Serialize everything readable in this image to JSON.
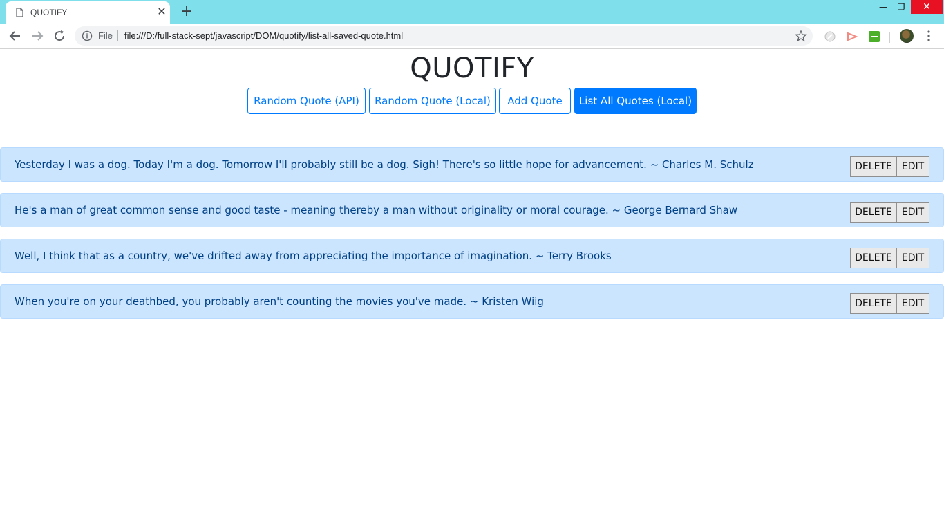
{
  "browser": {
    "tab_title": "QUOTIFY",
    "new_tab_label": "+",
    "close_tab_label": "✕",
    "scheme_label": "File",
    "url": "file:///D:/full-stack-sept/javascript/DOM/quotify/list-all-saved-quote.html",
    "window_controls": {
      "minimize": "—",
      "maximize": "❐",
      "close": "✕"
    },
    "colors": {
      "tabstrip": "#7fe0eb",
      "close": "#e81123"
    }
  },
  "page": {
    "title": "QUOTIFY",
    "nav_buttons": [
      {
        "label": "Random Quote (API)",
        "active": false
      },
      {
        "label": "Random Quote (Local)",
        "active": false
      },
      {
        "label": "Add Quote",
        "active": false
      },
      {
        "label": "List All Quotes (Local)",
        "active": true
      }
    ],
    "quotes": [
      {
        "text": "Yesterday I was a dog. Today I'm a dog. Tomorrow I'll probably still be a dog. Sigh! There's so little hope for advancement. ~ Charles M. Schulz",
        "delete_label": "DELETE",
        "edit_label": "EDIT"
      },
      {
        "text": "He's a man of great common sense and good taste - meaning thereby a man without originality or moral courage. ~ George Bernard Shaw",
        "delete_label": "DELETE",
        "edit_label": "EDIT"
      },
      {
        "text": "Well, I think that as a country, we've drifted away from appreciating the importance of imagination. ~ Terry Brooks",
        "delete_label": "DELETE",
        "edit_label": "EDIT"
      },
      {
        "text": "When you're on your deathbed, you probably aren't counting the movies you've made. ~ Kristen Wiig",
        "delete_label": "DELETE",
        "edit_label": "EDIT"
      }
    ],
    "colors": {
      "primary": "#007bff",
      "quote_bg": "#cce5ff",
      "quote_text": "#004085"
    }
  }
}
